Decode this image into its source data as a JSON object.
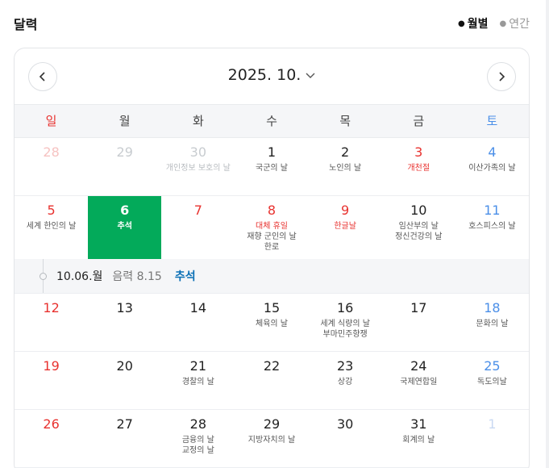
{
  "header": {
    "title": "달력"
  },
  "view_toggle": {
    "month_label": "월별",
    "year_label": "연간"
  },
  "month_nav": {
    "title": "2025. 10."
  },
  "weekdays": [
    "일",
    "월",
    "화",
    "수",
    "목",
    "금",
    "토"
  ],
  "weeks": [
    [
      {
        "num": "28",
        "events": []
      },
      {
        "num": "29",
        "events": []
      },
      {
        "num": "30",
        "events": [
          "개인정보 보호의 날"
        ]
      },
      {
        "num": "1",
        "events": [
          "국군의 날"
        ]
      },
      {
        "num": "2",
        "events": [
          "노인의 날"
        ]
      },
      {
        "num": "3",
        "events": [
          "개천절"
        ]
      },
      {
        "num": "4",
        "events": [
          "이산가족의 날"
        ]
      }
    ],
    [
      {
        "num": "5",
        "events": [
          "세계 한인의 날"
        ]
      },
      {
        "num": "6",
        "events": [
          "추석"
        ]
      },
      {
        "num": "7",
        "events": []
      },
      {
        "num": "8",
        "events": [
          "대체 휴일",
          "재향 군인의 날",
          "한로"
        ]
      },
      {
        "num": "9",
        "events": [
          "한글날"
        ]
      },
      {
        "num": "10",
        "events": [
          "임산부의 날",
          "정신건강의 날"
        ]
      },
      {
        "num": "11",
        "events": [
          "호스피스의 날"
        ]
      }
    ],
    [
      {
        "num": "12",
        "events": []
      },
      {
        "num": "13",
        "events": []
      },
      {
        "num": "14",
        "events": []
      },
      {
        "num": "15",
        "events": [
          "체육의 날"
        ]
      },
      {
        "num": "16",
        "events": [
          "세계 식량의 날",
          "부마민주항쟁"
        ]
      },
      {
        "num": "17",
        "events": []
      },
      {
        "num": "18",
        "events": [
          "문화의 날"
        ]
      }
    ],
    [
      {
        "num": "19",
        "events": []
      },
      {
        "num": "20",
        "events": []
      },
      {
        "num": "21",
        "events": [
          "경찰의 날"
        ]
      },
      {
        "num": "22",
        "events": []
      },
      {
        "num": "23",
        "events": [
          "상강"
        ]
      },
      {
        "num": "24",
        "events": [
          "국제연합일"
        ]
      },
      {
        "num": "25",
        "events": [
          "독도의날"
        ]
      }
    ],
    [
      {
        "num": "26",
        "events": []
      },
      {
        "num": "27",
        "events": []
      },
      {
        "num": "28",
        "events": [
          "금융의 날",
          "교정의 날"
        ]
      },
      {
        "num": "29",
        "events": [
          "지방자치의 날"
        ]
      },
      {
        "num": "30",
        "events": []
      },
      {
        "num": "31",
        "events": [
          "회계의 날"
        ]
      },
      {
        "num": "1",
        "events": []
      }
    ]
  ],
  "selected_detail": {
    "date": "10.06.월",
    "lunar": "음력 8.15",
    "event": "추석"
  },
  "colors": {
    "accent": "#03aa5a",
    "holiday": "#e8322f",
    "saturday": "#4b8fe8",
    "detail_link": "#0a6fb5"
  }
}
